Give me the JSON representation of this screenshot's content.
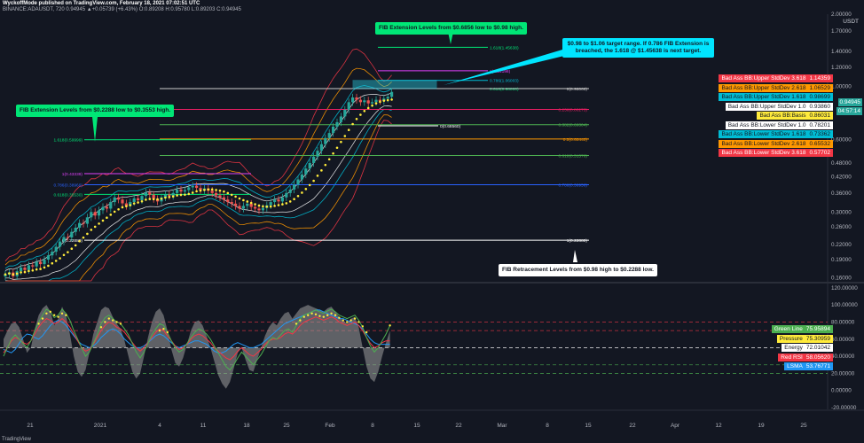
{
  "header": {
    "line1": "WyckoffMode published on TradingView.com, February 18, 2021 07:02:51 UTC",
    "line2": "BINANCE:ADAUSDT, 720  0.94945  ▲+0.05739 (+6.43%)  O:0.89208  H:0.95780  L:0.89203  C:0.94945",
    "currency": "USDT",
    "footer": "TradingView"
  },
  "callouts": {
    "fib_ext_high": "FIB Extension Levels from $0.6856 low to $0.98 high.",
    "target": "$0.98 to $1.06 target range. If 0.786 FIB Extension is breached, the 1.618 @ $1.45638 is next target.",
    "fib_ext_low": "FIB Extension Levels from $0.2288 low to $0.3553 high.",
    "fib_retrace": "FIB Retracement Levels from $0.98 high to $0.2288 low."
  },
  "fib_labels": {
    "upper": [
      "1.618(1.45638)",
      "1(1.16198)",
      "0.786(1.06003)",
      "0.618(0.98000)"
    ],
    "retrace": [
      "0(0.98000)",
      "0.236(0.80273)",
      "0.382(0.69304)",
      "0.5(0.60440)",
      "0.618(0.51576)",
      "0.786(0.38956)",
      "1(0.22880)"
    ],
    "lower": [
      "1.618(0.59999)",
      "1(0.43339)",
      "0.786(0.38969)",
      "0.618(0.35530)",
      "0(0.22880)"
    ],
    "mid": "0(0.68560)"
  },
  "colors": {
    "bg": "#131722",
    "up": "#26a69a",
    "down": "#ef5350",
    "green": "#00e676",
    "magenta": "#e040fb",
    "orange": "#ff9800",
    "yellow": "#ffeb3b",
    "cyan": "#00bcd4",
    "white": "#ffffff",
    "red": "#f23645",
    "blue": "#2196f3"
  },
  "legend": [
    {
      "label": "Bad Ass BB:Upper StdDev 3.618",
      "value": "1.14359",
      "bg": "#f23645",
      "fg": "#ffffff"
    },
    {
      "label": "Bad Ass BB:Upper StdDev 2.618",
      "value": "1.06529",
      "bg": "#ff9800",
      "fg": "#131722"
    },
    {
      "label": "Bad Ass BB:Upper StdDev 1.618",
      "value": "0.98699",
      "bg": "#00bcd4",
      "fg": "#131722"
    },
    {
      "label": "Bad Ass BB:Upper StdDev 1.0",
      "value": "0.93860",
      "bg": "#ffffff",
      "fg": "#131722"
    },
    {
      "label": "Bad Ass BB:Basis",
      "value": "0.86031",
      "bg": "#ffeb3b",
      "fg": "#131722"
    },
    {
      "label": "Bad Ass BB:Lower StdDev 1.0",
      "value": "0.78201",
      "bg": "#ffffff",
      "fg": "#131722"
    },
    {
      "label": "Bad Ass BB:Lower StdDev 1.618",
      "value": "0.73362",
      "bg": "#00bcd4",
      "fg": "#131722"
    },
    {
      "label": "Bad Ass BB:Lower StdDev 2.618",
      "value": "0.65532",
      "bg": "#ff9800",
      "fg": "#131722"
    },
    {
      "label": "Bad Ass BB:Lower StdDev 3.618",
      "value": "0.57702",
      "bg": "#f23645",
      "fg": "#ffffff"
    }
  ],
  "price_tags": {
    "last": "0.94945",
    "countdown": "04:57:14"
  },
  "osc_legend": [
    {
      "label": "Green Line",
      "value": "75.95894",
      "bg": "#4caf50",
      "fg": "#ffffff"
    },
    {
      "label": "Pressure",
      "value": "75.30959",
      "bg": "#ffeb3b",
      "fg": "#131722"
    },
    {
      "label": "Energy",
      "value": "72.01042",
      "bg": "#ffffff",
      "fg": "#131722"
    },
    {
      "label": "Red RSI",
      "value": "58.05620",
      "bg": "#f23645",
      "fg": "#ffffff"
    },
    {
      "label": "LSMA",
      "value": "53.76771",
      "bg": "#2196f3",
      "fg": "#ffffff"
    }
  ],
  "chart_data": {
    "type": "candlestick",
    "symbol": "BINANCE:ADAUSDT",
    "interval": "720",
    "y_scale": "log",
    "ylim": [
      0.155,
      2.0
    ],
    "price_ticks": [
      "2.00000",
      "1.70000",
      "1.40000",
      "1.20000",
      "1.00000",
      "0.60000",
      "0.48000",
      "0.42000",
      "0.36000",
      "0.30000",
      "0.26000",
      "0.22000",
      "0.19000",
      "0.16000"
    ],
    "price_tick_values": [
      2.0,
      1.7,
      1.4,
      1.2,
      1.0,
      0.6,
      0.48,
      0.42,
      0.36,
      0.3,
      0.26,
      0.22,
      0.19,
      0.16
    ],
    "x_labels": [
      "21",
      "2021",
      "4",
      "11",
      "18",
      "25",
      "Feb",
      "8",
      "15",
      "22",
      "Mar",
      "8",
      "15",
      "22",
      "Apr",
      "12",
      "19",
      "25"
    ],
    "osc_ticks": [
      "120.00000",
      "100.00000",
      "80.00000",
      "60.00000",
      "40.00000",
      "20.00000",
      "0.00000",
      "-20.00000"
    ],
    "osc_tick_values": [
      120,
      100,
      80,
      60,
      40,
      20,
      0,
      -20
    ],
    "osc_ylim": [
      -22,
      125
    ],
    "osc_levels": [
      80,
      70,
      50,
      30,
      20
    ],
    "closes": [
      0.165,
      0.168,
      0.162,
      0.17,
      0.176,
      0.172,
      0.18,
      0.178,
      0.186,
      0.182,
      0.19,
      0.198,
      0.205,
      0.215,
      0.226,
      0.236,
      0.235,
      0.248,
      0.258,
      0.27,
      0.268,
      0.285,
      0.3,
      0.29,
      0.305,
      0.315,
      0.31,
      0.33,
      0.345,
      0.338,
      0.326,
      0.318,
      0.33,
      0.342,
      0.336,
      0.35,
      0.362,
      0.354,
      0.34,
      0.332,
      0.345,
      0.355,
      0.35,
      0.36,
      0.372,
      0.365,
      0.37,
      0.38,
      0.386,
      0.378,
      0.37,
      0.376,
      0.368,
      0.36,
      0.352,
      0.345,
      0.338,
      0.33,
      0.325,
      0.318,
      0.31,
      0.318,
      0.325,
      0.315,
      0.31,
      0.305,
      0.312,
      0.32,
      0.33,
      0.338,
      0.332,
      0.345,
      0.36,
      0.372,
      0.39,
      0.41,
      0.43,
      0.455,
      0.48,
      0.51,
      0.54,
      0.575,
      0.61,
      0.64,
      0.68,
      0.71,
      0.75,
      0.8,
      0.86,
      0.9,
      0.88,
      0.86,
      0.875,
      0.85,
      0.86,
      0.88,
      0.87,
      0.89,
      0.905,
      0.949
    ],
    "osc_green": [
      40,
      50,
      60,
      65,
      60,
      55,
      50,
      58,
      70,
      80,
      88,
      95,
      92,
      85,
      88,
      95,
      90,
      82,
      70,
      60,
      50,
      40,
      45,
      55,
      65,
      78,
      85,
      88,
      84,
      80,
      78,
      72,
      65,
      55,
      45,
      38,
      45,
      55,
      65,
      72,
      78,
      76,
      68,
      58,
      50,
      45,
      48,
      55,
      62,
      68,
      72,
      70,
      66,
      60,
      52,
      44,
      36,
      28,
      24,
      30,
      38,
      45,
      40,
      35,
      30,
      36,
      42,
      50,
      58,
      62,
      60,
      65,
      70,
      72,
      68,
      76,
      84,
      88,
      90,
      92,
      94,
      92,
      90,
      93,
      95,
      92,
      88,
      86,
      84,
      86,
      88,
      82,
      74,
      62,
      52,
      45,
      50,
      58,
      66,
      76
    ],
    "osc_pressure": [
      null,
      null,
      null,
      null,
      null,
      null,
      null,
      null,
      null,
      78,
      84,
      90,
      92,
      88,
      86,
      90,
      88,
      null,
      null,
      null,
      null,
      null,
      null,
      null,
      null,
      74,
      80,
      84,
      82,
      80,
      78,
      null,
      null,
      null,
      null,
      null,
      null,
      null,
      null,
      null,
      70,
      72,
      68,
      null,
      null,
      null,
      null,
      null,
      null,
      null,
      null,
      null,
      null,
      null,
      null,
      null,
      null,
      null,
      null,
      null,
      null,
      null,
      null,
      null,
      null,
      null,
      null,
      null,
      null,
      null,
      null,
      null,
      null,
      null,
      null,
      78,
      82,
      86,
      88,
      90,
      89,
      87,
      86,
      88,
      90,
      88,
      85,
      82,
      80,
      82,
      84,
      80,
      75,
      68,
      null,
      null,
      null,
      null,
      null,
      76
    ],
    "osc_red": [
      44,
      50,
      58,
      62,
      60,
      56,
      54,
      58,
      66,
      74,
      80,
      84,
      82,
      78,
      80,
      84,
      80,
      74,
      66,
      58,
      50,
      46,
      48,
      54,
      62,
      70,
      76,
      80,
      78,
      74,
      72,
      68,
      62,
      56,
      50,
      46,
      50,
      56,
      62,
      68,
      72,
      70,
      64,
      58,
      52,
      48,
      50,
      54,
      60,
      64,
      66,
      64,
      60,
      56,
      50,
      46,
      42,
      38,
      36,
      40,
      46,
      50,
      46,
      42,
      40,
      44,
      48,
      54,
      58,
      60,
      60,
      62,
      66,
      68,
      66,
      70,
      76,
      80,
      82,
      84,
      86,
      84,
      82,
      84,
      86,
      84,
      80,
      78,
      76,
      78,
      80,
      76,
      70,
      62,
      55,
      50,
      52,
      56,
      58,
      58
    ],
    "osc_lsma": [
      48,
      46,
      44,
      48,
      55,
      62,
      66,
      65,
      62,
      60,
      64,
      70,
      76,
      80,
      82,
      80,
      76,
      70,
      64,
      58,
      54,
      52,
      50,
      52,
      56,
      62,
      66,
      70,
      72,
      70,
      66,
      60,
      56,
      52,
      50,
      50,
      52,
      56,
      60,
      64,
      66,
      64,
      60,
      56,
      52,
      50,
      52,
      54,
      56,
      58,
      58,
      56,
      54,
      50,
      46,
      44,
      44,
      46,
      50,
      54,
      56,
      54,
      52,
      50,
      50,
      52,
      54,
      58,
      62,
      66,
      70,
      74,
      78,
      80,
      82,
      84,
      86,
      88,
      90,
      92,
      94,
      94,
      92,
      90,
      88,
      86,
      84,
      84,
      82,
      80,
      78,
      76,
      72,
      66,
      60,
      56,
      54,
      54,
      54,
      54
    ],
    "osc_energy": [
      60,
      70,
      78,
      80,
      74,
      60,
      44,
      50,
      72,
      88,
      96,
      100,
      92,
      76,
      84,
      98,
      88,
      66,
      40,
      22,
      16,
      24,
      44,
      66,
      80,
      94,
      98,
      96,
      86,
      78,
      72,
      58,
      40,
      22,
      14,
      20,
      40,
      62,
      80,
      92,
      96,
      88,
      70,
      48,
      32,
      28,
      38,
      54,
      70,
      80,
      82,
      76,
      64,
      50,
      34,
      18,
      8,
      2,
      10,
      26,
      44,
      50,
      36,
      24,
      22,
      36,
      50,
      64,
      74,
      80,
      76,
      84,
      90,
      92,
      84,
      90,
      96,
      98,
      100,
      98,
      96,
      94,
      92,
      96,
      98,
      92,
      86,
      82,
      78,
      84,
      86,
      74,
      50,
      28,
      14,
      10,
      22,
      40,
      56,
      70
    ]
  }
}
